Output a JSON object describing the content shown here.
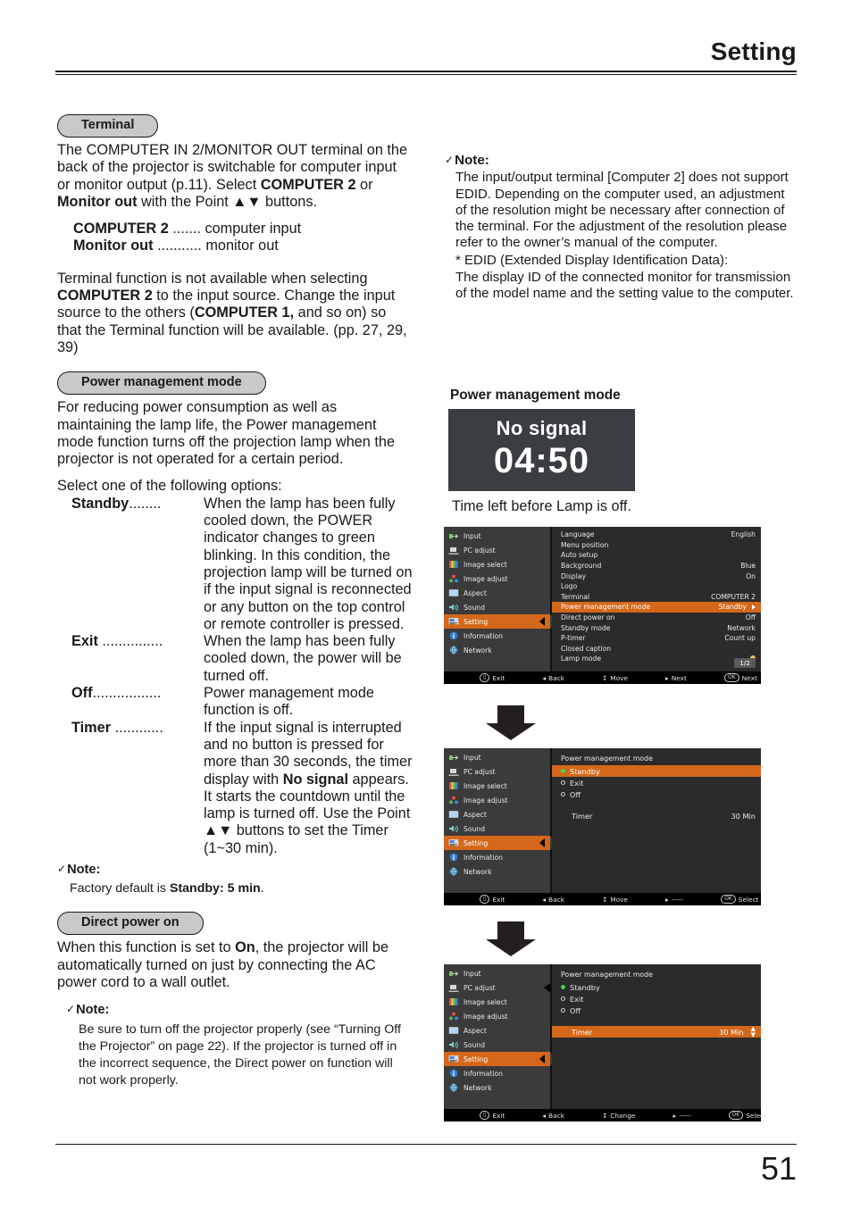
{
  "header": {
    "title": "Setting"
  },
  "footer": {
    "page_number": "51"
  },
  "left_column": {
    "terminal": {
      "pill_label": "Terminal",
      "para1_html": "The COMPUTER IN 2/MONITOR OUT terminal on the back of the projector is switchable for computer input or monitor output (p.11). Select <b>COMPUTER 2</b> or <b>Monitor out</b> with the Point ▲▼ buttons.",
      "definitions": [
        {
          "term": "COMPUTER 2",
          "dots": " .......",
          "desc": "computer input"
        },
        {
          "term": "Monitor out",
          "dots": " ...........",
          "desc": "monitor out"
        }
      ],
      "para2_html": "Terminal function is not available when selecting <b>COMPUTER 2</b> to the input source. Change the input source to the others (<b>COMPUTER 1,</b> and so on) so that the Terminal function will be available. (pp. 27, 29, 39)"
    },
    "power_management": {
      "pill_label": "Power management mode",
      "para1": "For reducing power consumption as well as maintaining the lamp life, the Power management mode function turns off the projection lamp when the projector is not operated for a certain period.",
      "para2": "Select one of the following options:",
      "options": [
        {
          "term": "Standby",
          "dots": "........",
          "desc_html": "When the lamp has been fully cooled down, the POWER indicator changes to green blinking. In this condition, the projection lamp will be turned on if the input signal is reconnected or any button on the top control or remote controller is pressed."
        },
        {
          "term": "Exit",
          "dots": " ...............",
          "desc_html": "When the lamp has been fully cooled down, the power will be turned off."
        },
        {
          "term": "Off",
          "dots": ".................",
          "desc_html": "Power management mode function is off."
        },
        {
          "term": "Timer",
          "dots": " ............",
          "desc_html": "If the input signal is interrupted and no button is pressed for more than 30 seconds, the timer display with <b>No signal</b> appears. It starts the countdown until the lamp is turned off. Use the Point ▲▼ buttons to set the Timer (1~30 min)."
        }
      ],
      "note_heading": "Note:",
      "note_body_html": "Factory default is <b>Standby: 5 min</b>."
    },
    "direct_power_on": {
      "pill_label": "Direct power on",
      "para1_html": "When this function is set to <b>On</b>, the projector will be automatically turned on just by connecting the AC power cord to a wall outlet.",
      "note_heading": "Note:",
      "note_body": "Be sure to turn off the projector properly (see “Turning Off the Projector” on page 22).  If the projector is turned off in the incorrect sequence, the Direct power on function will not work properly."
    }
  },
  "right_column": {
    "note": {
      "heading": "Note:",
      "body": "The input/output terminal [Computer 2] does not support EDID. Depending on the computer used, an adjustment of the resolution might be necessary after connection of the terminal. For the adjustment of the resolution please refer to the owner’s manual of the computer.",
      "star_line": "* EDID (Extended Display Identification Data):",
      "star_body": "The display ID of the connected monitor for transmission of the model name and the setting value to the computer."
    },
    "pmm_figure": {
      "caption": "Power management mode",
      "osd_no_signal": "No signal",
      "osd_timer": "04:50",
      "sub_caption": "Time left before Lamp is off."
    }
  },
  "osd_sidebar": {
    "items": [
      {
        "label": "Input",
        "icon": "input-icon",
        "selected": false
      },
      {
        "label": "PC adjust",
        "icon": "pc-adjust-icon",
        "selected": false
      },
      {
        "label": "Image select",
        "icon": "image-select-icon",
        "selected": false
      },
      {
        "label": "Image adjust",
        "icon": "image-adjust-icon",
        "selected": false
      },
      {
        "label": "Aspect",
        "icon": "aspect-icon",
        "selected": false
      },
      {
        "label": "Sound",
        "icon": "sound-icon",
        "selected": false
      },
      {
        "label": "Setting",
        "icon": "setting-icon",
        "selected": true
      },
      {
        "label": "Information",
        "icon": "information-icon",
        "selected": false
      },
      {
        "label": "Network",
        "icon": "network-icon",
        "selected": false
      }
    ]
  },
  "osd_screen_1": {
    "rows": [
      {
        "label": "Language",
        "value": "English",
        "highlight": false
      },
      {
        "label": "Menu position",
        "value": "",
        "highlight": false
      },
      {
        "label": "Auto setup",
        "value": "",
        "highlight": false
      },
      {
        "label": "Background",
        "value": "Blue",
        "highlight": false
      },
      {
        "label": "Display",
        "value": "On",
        "highlight": false
      },
      {
        "label": "Logo",
        "value": "",
        "highlight": false
      },
      {
        "label": "Terminal",
        "value": "COMPUTER 2",
        "highlight": false
      },
      {
        "label": "Power management mode",
        "value": "Standby",
        "highlight": true
      },
      {
        "label": "Direct power on",
        "value": "Off",
        "highlight": false
      },
      {
        "label": "Standby mode",
        "value": "Network",
        "highlight": false
      },
      {
        "label": "P-timer",
        "value": "Count up",
        "highlight": false
      },
      {
        "label": "Closed caption",
        "value": "",
        "highlight": false
      },
      {
        "label": "Lamp mode",
        "value": "",
        "highlight": false
      }
    ],
    "page_badge": "1/2",
    "footer": [
      {
        "key": "menu",
        "label": "Exit"
      },
      {
        "key": "left",
        "label": "Back"
      },
      {
        "key": "updown",
        "label": "Move"
      },
      {
        "key": "right",
        "label": "Next"
      },
      {
        "key": "ok",
        "label": "Next"
      }
    ]
  },
  "osd_screen_2": {
    "title": "Power management mode",
    "options": [
      {
        "label": "Standby",
        "on": true,
        "highlight": true
      },
      {
        "label": "Exit",
        "on": false,
        "highlight": false
      },
      {
        "label": "Off",
        "on": false,
        "highlight": false
      }
    ],
    "timer_label": "Timer",
    "timer_value": "30  Min",
    "timer_highlight": false,
    "footer": [
      {
        "key": "menu",
        "label": "Exit"
      },
      {
        "key": "left",
        "label": "Back"
      },
      {
        "key": "updown",
        "label": "Move"
      },
      {
        "key": "right",
        "label": "-----"
      },
      {
        "key": "ok",
        "label": "Select"
      }
    ]
  },
  "osd_screen_3": {
    "title": "Power management mode",
    "options": [
      {
        "label": "Standby",
        "on": true,
        "highlight": false
      },
      {
        "label": "Exit",
        "on": false,
        "highlight": false
      },
      {
        "label": "Off",
        "on": false,
        "highlight": false
      }
    ],
    "timer_label": "Timer",
    "timer_value": "30  Min",
    "timer_highlight": true,
    "footer": [
      {
        "key": "menu",
        "label": "Exit"
      },
      {
        "key": "left",
        "label": "Back"
      },
      {
        "key": "updown",
        "label": "Change"
      },
      {
        "key": "right",
        "label": "-----"
      },
      {
        "key": "ok",
        "label": "Select"
      }
    ]
  },
  "colors": {
    "osd_highlight": "#d4671a",
    "osd_background": "#2b2b2b",
    "osd_sidebar": "#3b3b3b",
    "pill_fill": "#c9c9c9",
    "no_signal_bg": "#3a3d41"
  }
}
